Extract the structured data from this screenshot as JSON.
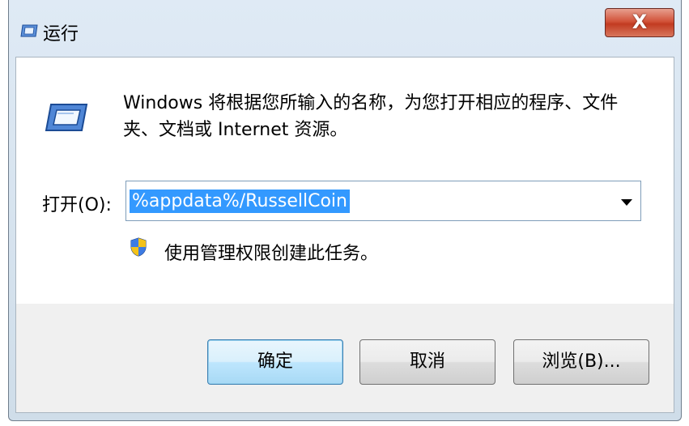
{
  "window": {
    "title": "运行",
    "close_label": "X"
  },
  "dialog": {
    "description": "Windows 将根据您所输入的名称，为您打开相应的程序、文件夹、文档或 Internet 资源。",
    "open_label": "打开(O):",
    "open_value": "%appdata%/RussellCoin",
    "admin_note": "使用管理权限创建此任务。"
  },
  "buttons": {
    "ok": "确定",
    "cancel": "取消",
    "browse": "浏览(B)..."
  },
  "icons": {
    "title": "run-icon",
    "large": "run-icon",
    "shield": "uac-shield-icon",
    "dropdown": "chevron-down-icon"
  },
  "colors": {
    "selection": "#3399ff",
    "close_button": "#c23b21",
    "default_button_border": "#3c7fb1"
  }
}
